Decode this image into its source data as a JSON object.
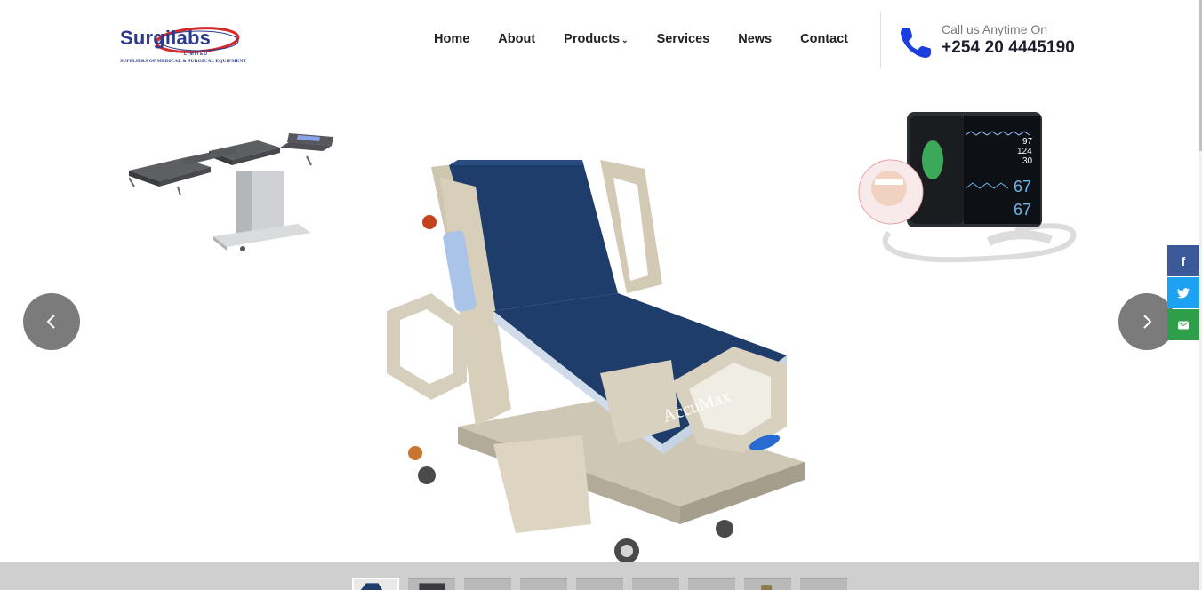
{
  "brand": {
    "name": "Surgilabs",
    "sub": "LIMITED",
    "tagline": "SUPPLIERS OF MEDICAL & SURGICAL EQUIPMENT",
    "color": "#2b3a8f",
    "swoosh_color": "#d42a2a"
  },
  "nav": {
    "items": [
      {
        "label": "Home"
      },
      {
        "label": "About"
      },
      {
        "label": "Products",
        "has_dropdown": true,
        "caret": "⌄"
      },
      {
        "label": "Services"
      },
      {
        "label": "News"
      },
      {
        "label": "Contact"
      }
    ]
  },
  "contact": {
    "call_label": "Call us Anytime On",
    "phone": "+254 20 4445190",
    "icon": "phone-icon",
    "icon_color": "#1a3ee0"
  },
  "slider": {
    "prev_icon": "chevron-left-icon",
    "next_icon": "chevron-right-icon",
    "slides": [
      {
        "name": "operating-table"
      },
      {
        "name": "hospital-bed"
      },
      {
        "name": "patient-monitor"
      }
    ],
    "monitor_values": [
      "97",
      "124",
      "30",
      "67",
      "67"
    ]
  },
  "share": {
    "facebook": "f",
    "twitter": "twitter-icon",
    "email": "email-icon",
    "colors": {
      "facebook": "#3b5998",
      "twitter": "#1da1f2",
      "email": "#2e9e48"
    }
  },
  "thumbnails": {
    "count": 9,
    "active_index": 0
  }
}
